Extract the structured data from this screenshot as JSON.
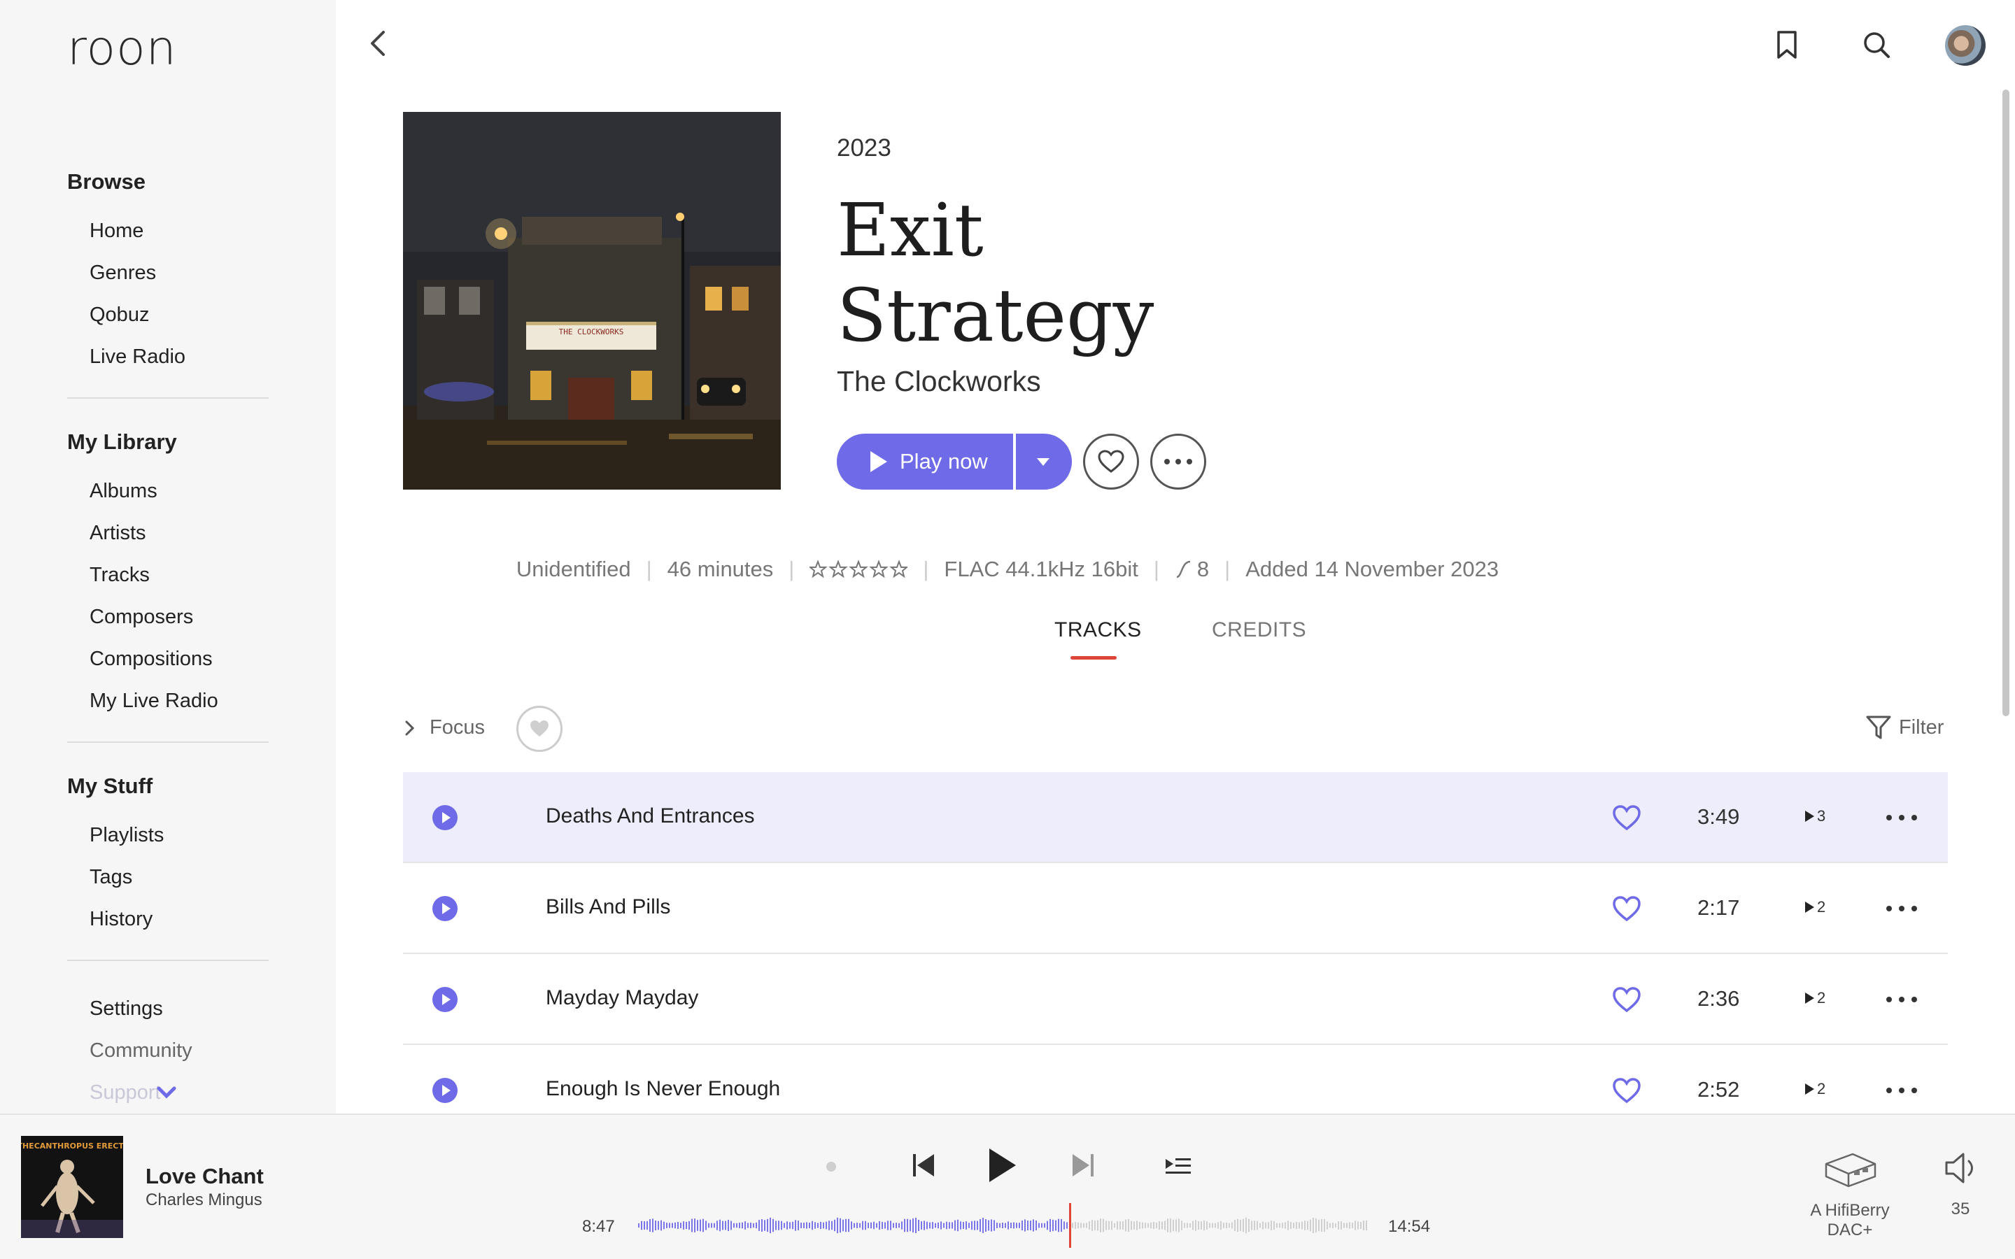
{
  "app": {
    "logo": "roon"
  },
  "sidebar": {
    "browse_title": "Browse",
    "browse_items": [
      "Home",
      "Genres",
      "Qobuz",
      "Live Radio"
    ],
    "library_title": "My Library",
    "library_items": [
      "Albums",
      "Artists",
      "Tracks",
      "Composers",
      "Compositions",
      "My Live Radio"
    ],
    "stuff_title": "My Stuff",
    "stuff_items": [
      "Playlists",
      "Tags",
      "History"
    ],
    "footer_items": [
      "Settings",
      "Community",
      "Support"
    ]
  },
  "album": {
    "year": "2023",
    "title_line1": "Exit",
    "title_line2": "Strategy",
    "artist": "The Clockworks",
    "cover_marquee": "THE CLOCKWORKS",
    "play_label": "Play now"
  },
  "meta": {
    "identification": "Unidentified",
    "duration": "46 minutes",
    "rating_stars": 0,
    "format": "FLAC 44.1kHz 16bit",
    "dynamic_range": "8",
    "added": "Added 14 November 2023"
  },
  "tabs": {
    "tracks": "TRACKS",
    "credits": "CREDITS",
    "active": "TRACKS"
  },
  "toolbar": {
    "focus_label": "Focus",
    "filter_label": "Filter"
  },
  "tracks": [
    {
      "title": "Deaths And Entrances",
      "duration": "3:49",
      "plays": "3",
      "highlighted": true
    },
    {
      "title": "Bills And Pills",
      "duration": "2:17",
      "plays": "2",
      "highlighted": false
    },
    {
      "title": "Mayday Mayday",
      "duration": "2:36",
      "plays": "2",
      "highlighted": false
    },
    {
      "title": "Enough Is Never Enough",
      "duration": "2:52",
      "plays": "2",
      "highlighted": false
    }
  ],
  "player": {
    "track_title": "Love Chant",
    "track_artist": "Charles Mingus",
    "cover_text": "PITHECANTHROPUS ERECTUS",
    "elapsed": "8:47",
    "total": "14:54",
    "progress_fraction": 0.589,
    "zone_name_line1": "A HifiBerry",
    "zone_name_line2": "DAC+",
    "volume": "35"
  },
  "colors": {
    "accent": "#6e6ae8",
    "tab_underline": "#e0453a",
    "highlight_row": "#ededfb",
    "sidebar_bg": "#f6f6f6"
  }
}
